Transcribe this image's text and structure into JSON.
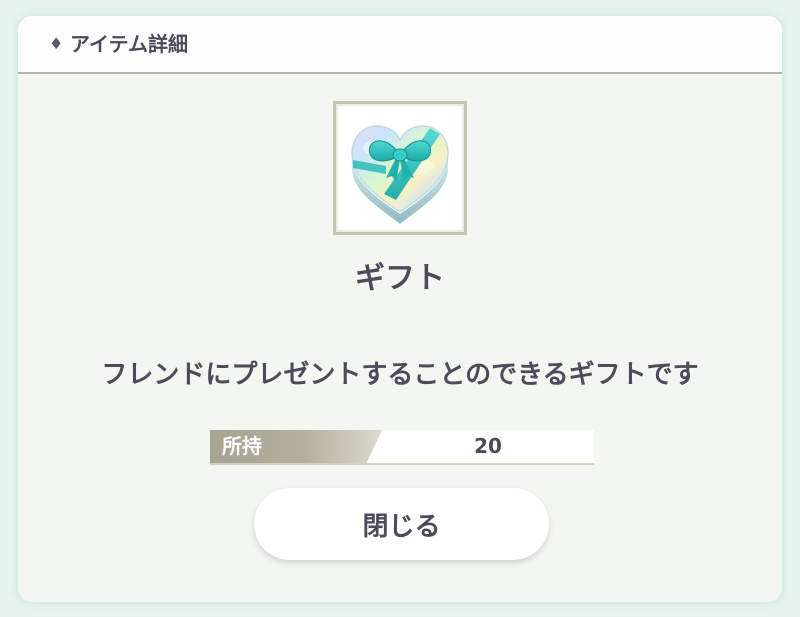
{
  "header": {
    "diamond": "♦",
    "title": "アイテム詳細"
  },
  "item": {
    "icon": "heart-gift-box-icon",
    "name": "ギフト",
    "description": "フレンドにプレゼントすることのできるギフトです"
  },
  "owned": {
    "label": "所持",
    "value": "20"
  },
  "close_button": {
    "label": "閉じる"
  },
  "colors": {
    "background": "#e6f3ef",
    "panel": "#f4f6f2",
    "text": "#4d4b5a",
    "ribbon": "#2ec5bf",
    "label_gradient_start": "#a6a393"
  }
}
